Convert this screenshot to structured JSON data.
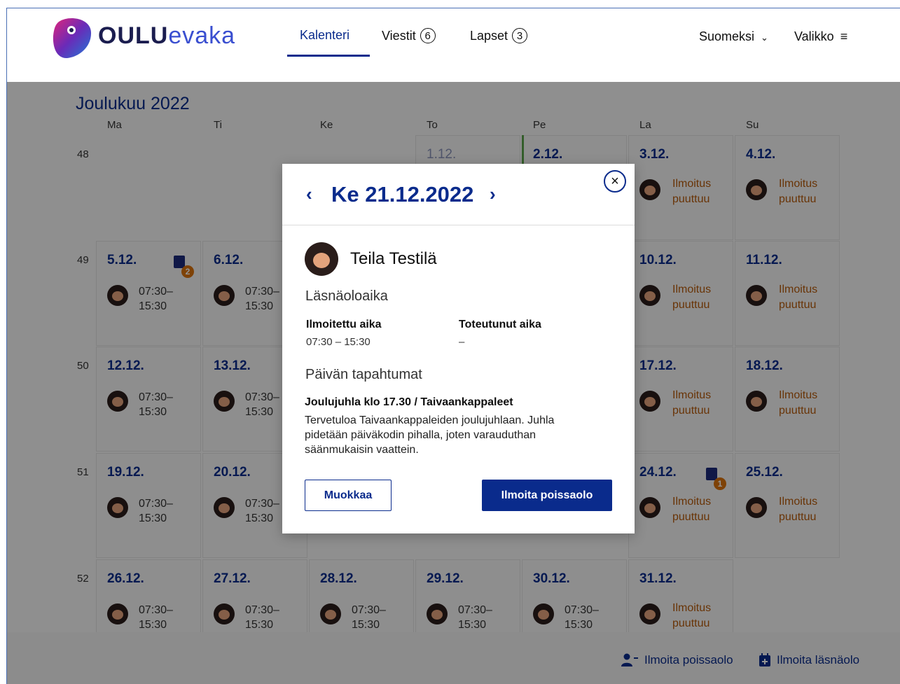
{
  "header": {
    "logo_bold": "OULU",
    "logo_light": "evaka",
    "nav": [
      {
        "label": "Kalenteri"
      },
      {
        "label": "Viestit",
        "count": "6"
      },
      {
        "label": "Lapset",
        "count": "3"
      }
    ],
    "language": "Suomeksi",
    "menu": "Valikko"
  },
  "calendar": {
    "month": "Joulukuu 2022",
    "day_names": [
      "Ma",
      "Ti",
      "Ke",
      "To",
      "Pe",
      "La",
      "Su"
    ],
    "weeks": [
      {
        "num": "48",
        "days": [
          {
            "date": ""
          },
          {
            "date": ""
          },
          {
            "date": ""
          },
          {
            "date": "1.12.",
            "past": true
          },
          {
            "date": "2.12."
          },
          {
            "date": "3.12.",
            "status": "Ilmoitus puuttuu"
          },
          {
            "date": "4.12.",
            "status": "Ilmoitus puuttuu"
          }
        ]
      },
      {
        "num": "49",
        "days": [
          {
            "date": "5.12.",
            "time": "07:30– 15:30",
            "badge": "2"
          },
          {
            "date": "6.12.",
            "time": "07:30– 15:30"
          },
          {
            "date": ""
          },
          {
            "date": ""
          },
          {
            "date": ""
          },
          {
            "date": "10.12.",
            "status": "Ilmoitus puuttuu"
          },
          {
            "date": "11.12.",
            "status": "Ilmoitus puuttuu"
          }
        ]
      },
      {
        "num": "50",
        "days": [
          {
            "date": "12.12.",
            "time": "07:30– 15:30"
          },
          {
            "date": "13.12.",
            "time": "07:30– 15:30"
          },
          {
            "date": ""
          },
          {
            "date": ""
          },
          {
            "date": ""
          },
          {
            "date": "17.12.",
            "status": "Ilmoitus puuttuu"
          },
          {
            "date": "18.12.",
            "status": "Ilmoitus puuttuu"
          }
        ]
      },
      {
        "num": "51",
        "days": [
          {
            "date": "19.12.",
            "time": "07:30– 15:30"
          },
          {
            "date": "20.12.",
            "time": "07:30– 15:30"
          },
          {
            "date": ""
          },
          {
            "date": ""
          },
          {
            "date": ""
          },
          {
            "date": "24.12.",
            "status": "Ilmoitus puuttuu",
            "badge": "1"
          },
          {
            "date": "25.12.",
            "status": "Ilmoitus puuttuu"
          }
        ]
      },
      {
        "num": "52",
        "days": [
          {
            "date": "26.12.",
            "time": "07:30– 15:30"
          },
          {
            "date": "27.12.",
            "time": "07:30– 15:30"
          },
          {
            "date": "28.12.",
            "time": "07:30– 15:30"
          },
          {
            "date": "29.12.",
            "time": "07:30– 15:30"
          },
          {
            "date": "30.12.",
            "time": "07:30– 15:30"
          },
          {
            "date": "31.12.",
            "status": "Ilmoitus puuttuu"
          },
          {
            "date": ""
          }
        ]
      }
    ]
  },
  "footer": {
    "report_absence": "Ilmoita poissaolo",
    "report_presence": "Ilmoita läsnäolo"
  },
  "modal": {
    "title": "Ke 21.12.2022",
    "prev": "‹",
    "next": "›",
    "close": "×",
    "child_name": "Teila Testilä",
    "section_attendance": "Läsnäoloaika",
    "reported_label": "Ilmoitettu aika",
    "reported_value": "07:30 – 15:30",
    "actual_label": "Toteutunut aika",
    "actual_value": "–",
    "section_events": "Päivän tapahtumat",
    "event_title": "Joulujuhla klo 17.30 / Taivaankappaleet",
    "event_text": "Tervetuloa Taivaankappaleiden joulujuhlaan. Juhla pidetään päiväkodin pihalla, joten varauduthan säänmukaisin vaattein.",
    "edit_button": "Muokkaa",
    "absence_button": "Ilmoita poissaolo"
  }
}
